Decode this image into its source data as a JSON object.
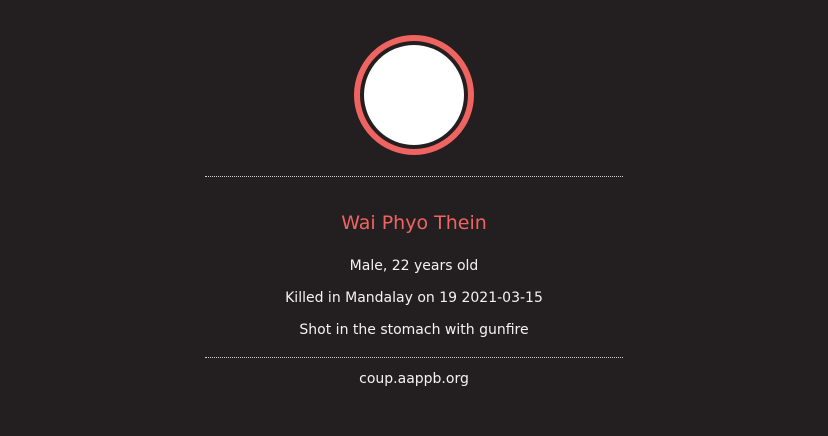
{
  "victim": {
    "name": "Wai Phyo Thein",
    "gender_age": "Male, 22 years old",
    "killed": "Killed in Mandalay on 19 2021-03-15",
    "cause": "Shot in the stomach with gunfire"
  },
  "footer": {
    "source": "coup.aappb.org"
  },
  "colors": {
    "background": "#231f20",
    "accent": "#ef6461",
    "text": "#ffffff"
  }
}
